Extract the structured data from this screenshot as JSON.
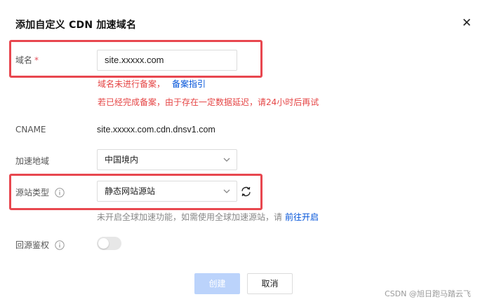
{
  "dialog": {
    "title": "添加自定义 CDN 加速域名",
    "close_glyph": "✕"
  },
  "domain": {
    "label": "域名",
    "required_mark": "*",
    "value": "site.xxxxx.com",
    "hint_not_filed": "域名未进行备案，",
    "hint_link": "备案指引",
    "hint_filed_delay": "若已经完成备案，由于存在一定数据延迟，请24小时后再试"
  },
  "cname": {
    "label": "CNAME",
    "value": "site.xxxxx.com.cdn.dnsv1.com"
  },
  "region": {
    "label": "加速地域",
    "selected": "中国境内"
  },
  "origin_type": {
    "label": "源站类型",
    "selected": "静态网站源站",
    "hint_text": "未开启全球加速功能，如需使用全球加速源站，请",
    "hint_link": "前往开启"
  },
  "origin_auth": {
    "label": "回源鉴权",
    "enabled": false
  },
  "buttons": {
    "create": "创建",
    "cancel": "取消"
  },
  "icons": {
    "close": "close-icon",
    "info": "info-icon",
    "chevron": "chevron-down-icon",
    "refresh": "refresh-icon"
  },
  "colors": {
    "required": "#e34d59",
    "error_text": "#e54545",
    "link": "#0052d9",
    "primary_disabled": "#bbd3fb",
    "highlight_border": "#e8474f"
  },
  "watermark": "CSDN @旭日跑马踏云飞"
}
